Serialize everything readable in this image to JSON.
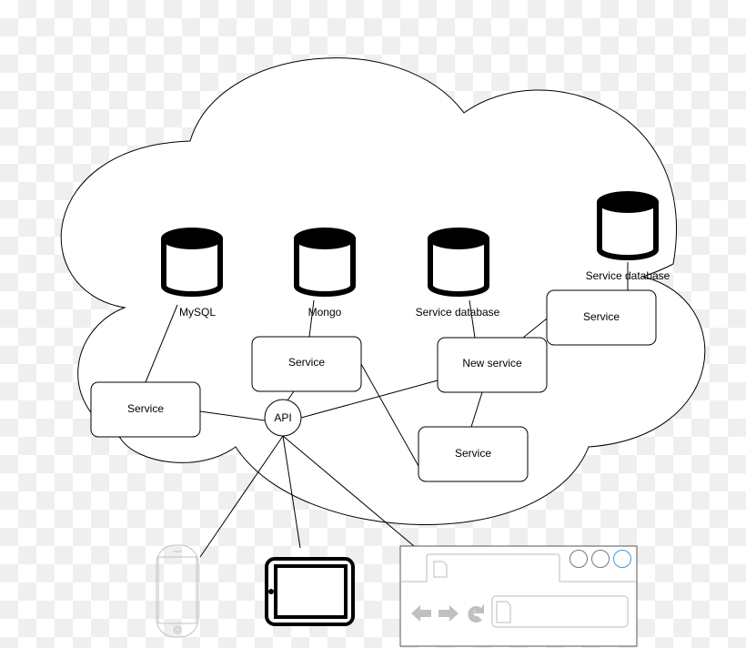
{
  "diagram": {
    "databases": [
      {
        "label": "MySQL"
      },
      {
        "label": "Mongo"
      },
      {
        "label": "Service database"
      },
      {
        "label": "Service database"
      }
    ],
    "services": [
      {
        "label": "Service"
      },
      {
        "label": "Service"
      },
      {
        "label": "New service"
      },
      {
        "label": "Service"
      },
      {
        "label": "Service"
      }
    ],
    "api": {
      "label": "API"
    },
    "clients": [
      {
        "icon": "smartphone-icon"
      },
      {
        "icon": "tablet-icon"
      },
      {
        "icon": "browser-window-icon"
      }
    ],
    "colors": {
      "line": "#000000",
      "client_gray": "#c0c0c0",
      "browser_active_button": "#3b9be0"
    }
  }
}
